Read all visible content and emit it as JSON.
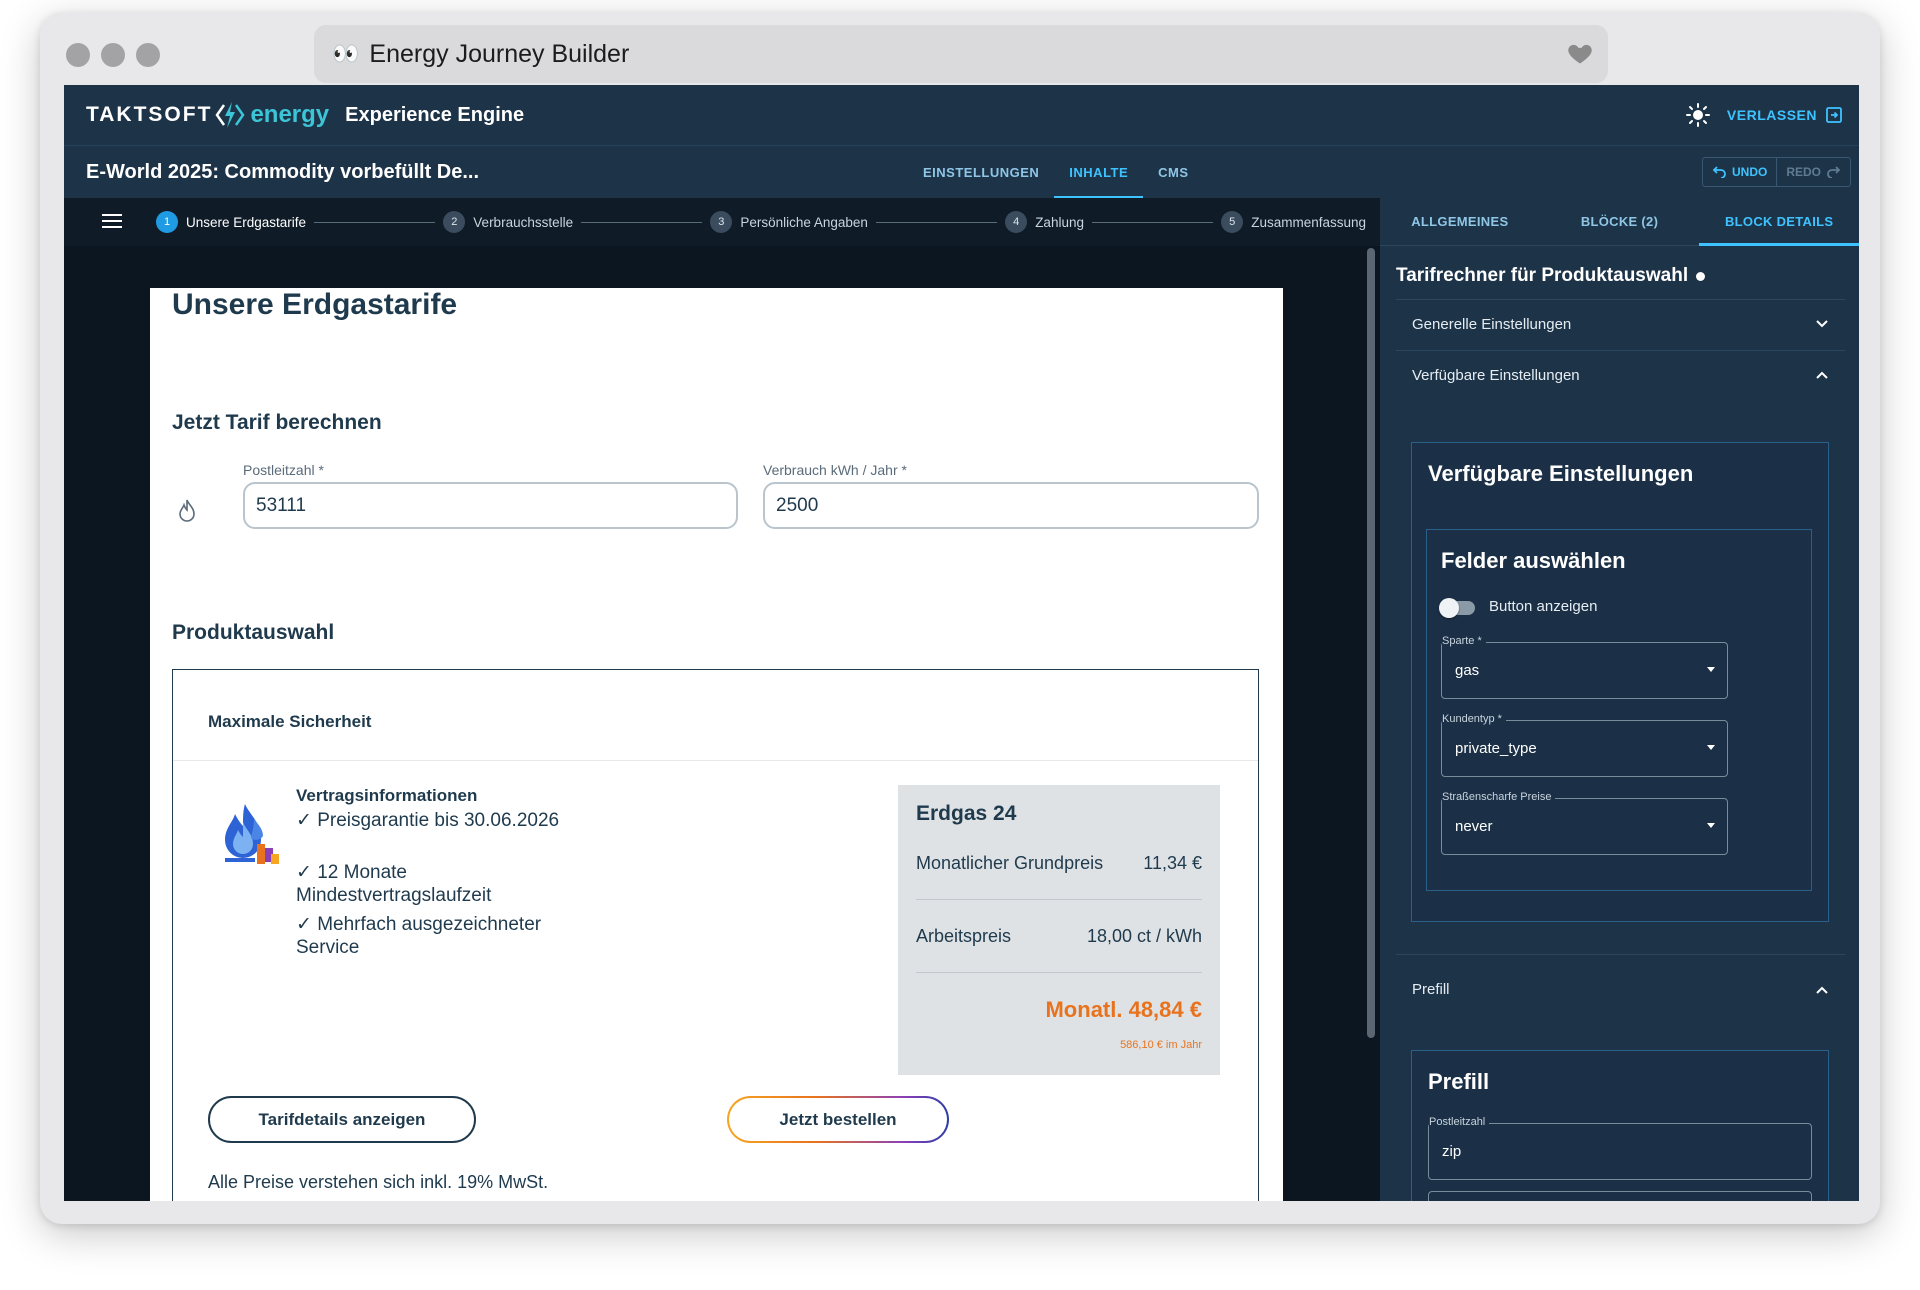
{
  "browser": {
    "url_emoji": "👀",
    "tab_title": "Energy Journey Builder"
  },
  "header": {
    "logo_text": "TAKTSOFT",
    "logo_energy": "energy",
    "product": "Experience Engine",
    "leave_label": "VERLASSEN"
  },
  "toolbar": {
    "doc_title": "E-World 2025: Commodity vorbefüllt De...",
    "tabs": [
      {
        "label": "EINSTELLUNGEN",
        "active": false
      },
      {
        "label": "INHALTE",
        "active": true
      },
      {
        "label": "CMS",
        "active": false
      }
    ],
    "undo_label": "UNDO",
    "redo_label": "REDO"
  },
  "stepper": {
    "steps": [
      {
        "num": "1",
        "label": "Unsere Erdgastarife",
        "active": true
      },
      {
        "num": "2",
        "label": "Verbrauchsstelle",
        "active": false
      },
      {
        "num": "3",
        "label": "Persönliche Angaben",
        "active": false
      },
      {
        "num": "4",
        "label": "Zahlung",
        "active": false
      },
      {
        "num": "5",
        "label": "Zusammenfassung",
        "active": false
      }
    ]
  },
  "page": {
    "title": "Unsere Erdgastarife",
    "calc_title": "Jetzt Tarif berechnen",
    "zip_label": "Postleitzahl *",
    "zip_value": "53111",
    "usage_label": "Verbrauch kWh / Jahr *",
    "usage_value": "2500",
    "product_title": "Produktauswahl",
    "product": {
      "name": "Maximale Sicherheit",
      "info_title": "Vertragsinformationen",
      "info_items": [
        "✓ Preisgarantie bis 30.06.2026",
        "✓ 12 Monate Mindestvertragslaufzeit",
        "✓ Mehrfach ausgezeichneter Service"
      ],
      "tariff_name": "Erdgas 24",
      "base_price_label": "Monatlicher Grundpreis",
      "base_price_value": "11,34 €",
      "work_price_label": "Arbeitspreis",
      "work_price_value": "18,00 ct / kWh",
      "monthly_total": "Monatl. 48,84 €",
      "yearly_total": "586,10 € im Jahr",
      "details_button": "Tarifdetails anzeigen",
      "order_button": "Jetzt bestellen",
      "vat_note": "Alle Preise verstehen sich inkl. 19% MwSt."
    }
  },
  "panel": {
    "tabs": [
      {
        "label": "ALLGEMEINES",
        "active": false
      },
      {
        "label": "BLÖCKE (2)",
        "active": false
      },
      {
        "label": "BLOCK DETAILS",
        "active": true
      }
    ],
    "title": "Tarifrechner für Produktauswahl",
    "acc_general": "Generelle Einstellungen",
    "acc_available": "Verfügbare Einstellungen",
    "card_available_title": "Verfügbare Einstellungen",
    "card_fields_title": "Felder auswählen",
    "toggle_label": "Button anzeigen",
    "toggle_on": false,
    "select_sparte_label": "Sparte *",
    "select_sparte_value": "gas",
    "select_kundentyp_label": "Kundentyp *",
    "select_kundentyp_value": "private_type",
    "select_strassen_label": "Straßenscharfe Preise",
    "select_strassen_value": "never",
    "acc_prefill": "Prefill",
    "card_prefill_title": "Prefill",
    "prefill_zip_label": "Postleitzahl",
    "prefill_zip_value": "zip"
  },
  "colors": {
    "header_bg": "#1d3348",
    "accent": "#3ec3ff",
    "price_accent": "#e8731e",
    "text_dark": "#1f3a4d"
  }
}
